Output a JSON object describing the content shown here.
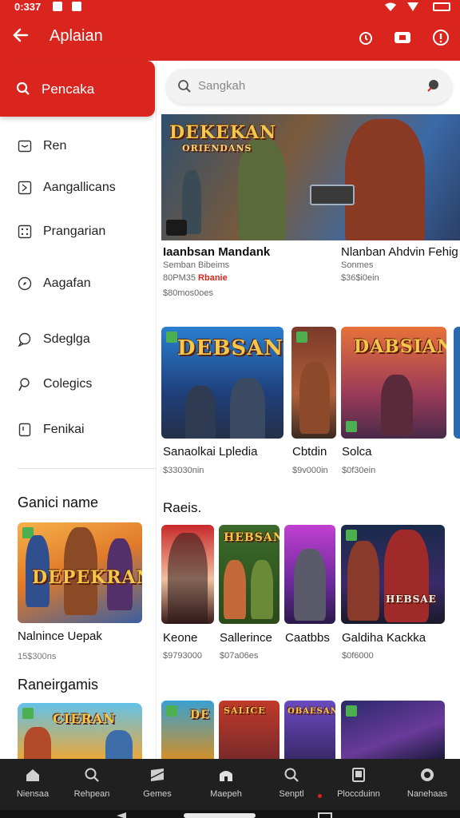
{
  "status_bar": {
    "time": "0:337"
  },
  "app_bar": {
    "title": "Aplaian"
  },
  "sidebar": {
    "search_label": "Pencaka",
    "items": [
      {
        "label": "Ren",
        "icon": "box-icon"
      },
      {
        "label": "Aangallicans",
        "icon": "tag-icon"
      },
      {
        "label": "Prangarian",
        "icon": "grid-icon"
      },
      {
        "label": "Aagafan",
        "icon": "compass-icon"
      },
      {
        "label": "Sdeglga",
        "icon": "chat-icon"
      },
      {
        "label": "Colegics",
        "icon": "user-icon"
      },
      {
        "label": "Fenikai",
        "icon": "book-icon"
      }
    ],
    "sections": [
      {
        "heading": "Ganici name",
        "game_title": "Nalnince Uepak",
        "game_meta": "15$300ns",
        "art_text": "DEPEKRAN"
      },
      {
        "heading": "Raneirgamis",
        "art_text": "CIERAN"
      }
    ]
  },
  "search": {
    "placeholder": "Sangkah"
  },
  "featured": {
    "art_text_1": "DEKEKAN",
    "art_text_2": "ORIENDANS",
    "games": [
      {
        "title": "Iaanbsan Mandank",
        "line1": "Semban Bibeims",
        "line2a": "80PM35",
        "line2b": "Rbanie",
        "line3": "$80mos0oes"
      },
      {
        "title": "Nlanban Ahdvin Fehig",
        "line1": "Sonmes",
        "line2": "$36$i0ein"
      }
    ]
  },
  "row1": {
    "games": [
      {
        "title": "Sanaolkai Lpledia",
        "price": "$33030nin",
        "art_text": "DEBSAN"
      },
      {
        "title": "Cbtdin",
        "price": "$9v000in",
        "art_text": ""
      },
      {
        "title": "Solca",
        "price": "$0f30ein",
        "art_text": "DABSIAN"
      }
    ]
  },
  "row2_title": "Raeis.",
  "row2": {
    "games": [
      {
        "title": "Keone",
        "price": "$9793000",
        "art_text": ""
      },
      {
        "title": "Sallerince",
        "price": "$07a06es",
        "art_text": "HEBSAN"
      },
      {
        "title": "Caatbbs",
        "price": "",
        "art_text": ""
      },
      {
        "title": "Galdiha Kackka",
        "price": "$0f6000",
        "art_text": "HEBSAE"
      }
    ]
  },
  "row3": {
    "art_texts": [
      "DE",
      "SALICE",
      "OBAESAN",
      ""
    ]
  },
  "bottom_nav": [
    {
      "label": "Niensaa",
      "icon": "home-icon"
    },
    {
      "label": "Rehpean",
      "icon": "search-icon"
    },
    {
      "label": "Gemes",
      "icon": "games-icon"
    },
    {
      "label": "Maepeh",
      "icon": "library-icon"
    },
    {
      "label": "Senptl",
      "icon": "search2-icon"
    },
    {
      "label": "Ploccduinn",
      "icon": "tablet-icon"
    },
    {
      "label": "Nanehaas",
      "icon": "profile-icon"
    }
  ],
  "colors": {
    "accent": "#d9251d",
    "nav_bg": "#202020"
  }
}
